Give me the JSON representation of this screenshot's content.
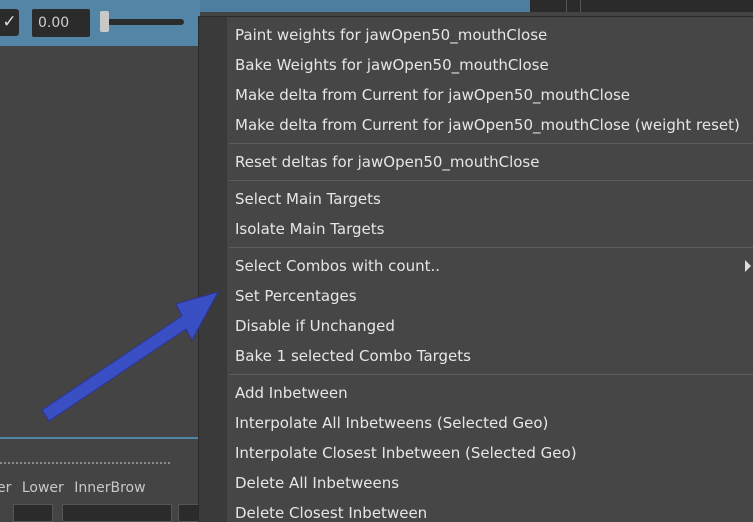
{
  "background": {
    "checkbox_glyph": "✓",
    "value_field": "0.00",
    "bottom_labels": [
      "er",
      "Lower",
      "InnerBrow"
    ]
  },
  "context_menu": {
    "groups": [
      {
        "items": [
          {
            "label": "Paint weights for jawOpen50_mouthClose"
          },
          {
            "label": "Bake Weights for jawOpen50_mouthClose"
          },
          {
            "label": "Make delta from Current for jawOpen50_mouthClose"
          },
          {
            "label": "Make delta from Current for jawOpen50_mouthClose (weight reset)"
          }
        ]
      },
      {
        "items": [
          {
            "label": "Reset deltas for jawOpen50_mouthClose"
          }
        ]
      },
      {
        "items": [
          {
            "label": "Select Main Targets"
          },
          {
            "label": "Isolate Main Targets"
          }
        ]
      },
      {
        "items": [
          {
            "label": "Select Combos with count..",
            "submenu": true
          },
          {
            "label": "Set Percentages"
          },
          {
            "label": "Disable if Unchanged"
          },
          {
            "label": "Bake 1 selected Combo Targets"
          }
        ]
      },
      {
        "items": [
          {
            "label": "Add Inbetween"
          },
          {
            "label": "Interpolate All Inbetweens (Selected Geo)"
          },
          {
            "label": "Interpolate Closest Inbetween (Selected Geo)"
          },
          {
            "label": "Delete All Inbetweens"
          },
          {
            "label": "Delete Closest Inbetween"
          }
        ]
      }
    ]
  },
  "annotation": {
    "arrow_color": "#3a4fc4",
    "arrow_target": "Set Percentages"
  },
  "colors": {
    "accent_blue": "#5285a6",
    "menu_background": "#464646",
    "menu_text": "#e6e6e6"
  }
}
